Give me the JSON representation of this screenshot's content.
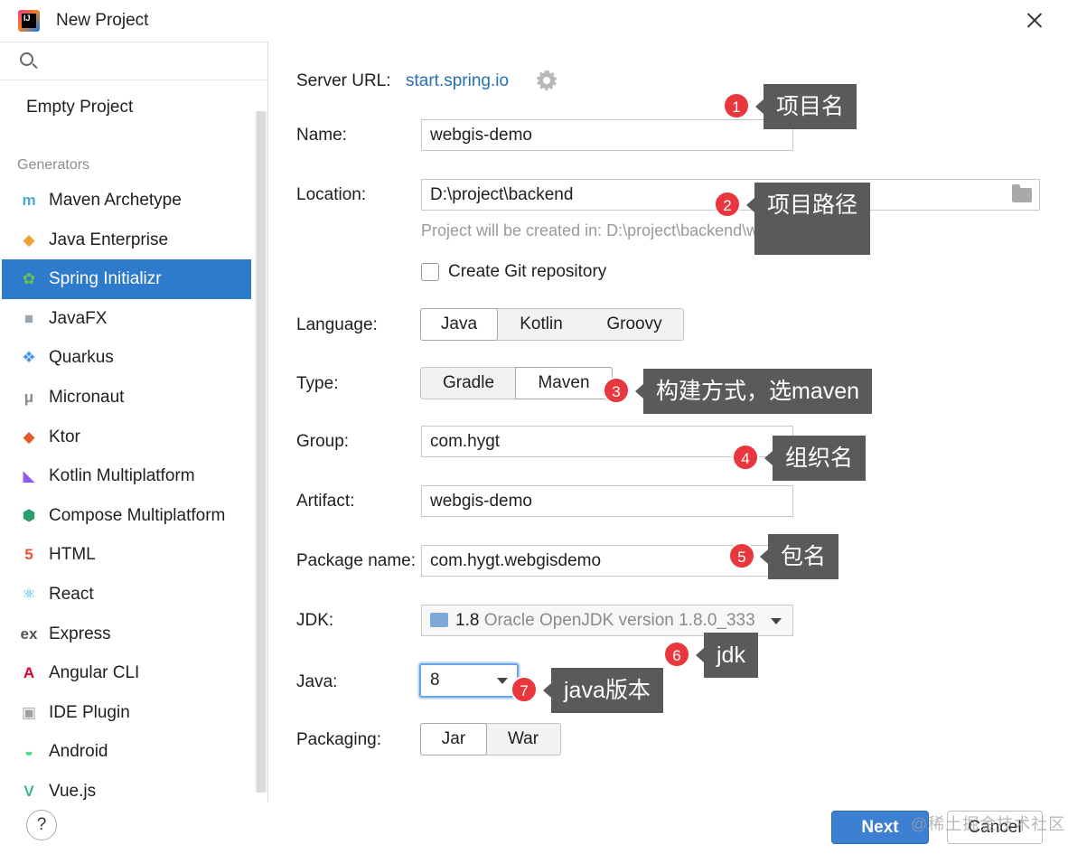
{
  "window": {
    "title": "New Project"
  },
  "sidebar": {
    "search_placeholder": "",
    "empty_project": "Empty Project",
    "generators_label": "Generators",
    "items": [
      {
        "label": "Maven Archetype",
        "icon": "maven-icon",
        "glyph": "m",
        "color": "#4aa8e0"
      },
      {
        "label": "Java Enterprise",
        "icon": "java-enterprise-icon",
        "glyph": "◆",
        "color": "#f0a030"
      },
      {
        "label": "Spring Initializr",
        "icon": "spring-icon",
        "glyph": "✿",
        "color": "#6cc24a",
        "selected": true
      },
      {
        "label": "JavaFX",
        "icon": "javafx-icon",
        "glyph": "■",
        "color": "#9aa7b4"
      },
      {
        "label": "Quarkus",
        "icon": "quarkus-icon",
        "glyph": "❖",
        "color": "#4695eb"
      },
      {
        "label": "Micronaut",
        "icon": "micronaut-icon",
        "glyph": "μ",
        "color": "#8a8a8a"
      },
      {
        "label": "Ktor",
        "icon": "ktor-icon",
        "glyph": "◆",
        "color": "#e35a2f"
      },
      {
        "label": "Kotlin Multiplatform",
        "icon": "kotlin-icon",
        "glyph": "◣",
        "color": "#8f5bf5"
      },
      {
        "label": "Compose Multiplatform",
        "icon": "compose-icon",
        "glyph": "⬢",
        "color": "#2a9d6e"
      },
      {
        "label": "HTML",
        "icon": "html5-icon",
        "glyph": "5",
        "color": "#e4572e"
      },
      {
        "label": "React",
        "icon": "react-icon",
        "glyph": "⚛",
        "color": "#3bb5d9"
      },
      {
        "label": "Express",
        "icon": "express-icon",
        "glyph": "ex",
        "color": "#555555"
      },
      {
        "label": "Angular CLI",
        "icon": "angular-icon",
        "glyph": "A",
        "color": "#d6002f"
      },
      {
        "label": "IDE Plugin",
        "icon": "ide-plugin-icon",
        "glyph": "▣",
        "color": "#a0a0a0"
      },
      {
        "label": "Android",
        "icon": "android-icon",
        "glyph": "◒",
        "color": "#3ddc84"
      },
      {
        "label": "Vue.js",
        "icon": "vue-icon",
        "glyph": "V",
        "color": "#41b883"
      }
    ]
  },
  "form": {
    "server_url_label": "Server URL:",
    "server_url": "start.spring.io",
    "name_label": "Name:",
    "name_value": "webgis-demo",
    "location_label": "Location:",
    "location_value": "D:\\project\\backend",
    "location_hint": "Project will be created in: D:\\project\\backend\\webgis-demo",
    "git_label": "Create Git repository",
    "language_label": "Language:",
    "languages": [
      "Java",
      "Kotlin",
      "Groovy"
    ],
    "type_label": "Type:",
    "types": [
      "Gradle",
      "Maven"
    ],
    "group_label": "Group:",
    "group_value": "com.hygt",
    "artifact_label": "Artifact:",
    "artifact_value": "webgis-demo",
    "package_label": "Package name:",
    "package_value": "com.hygt.webgisdemo",
    "jdk_label": "JDK:",
    "jdk_version": "1.8",
    "jdk_desc": "Oracle OpenJDK version 1.8.0_333",
    "java_label": "Java:",
    "java_value": "8",
    "packaging_label": "Packaging:",
    "packagings": [
      "Jar",
      "War"
    ]
  },
  "annotations": [
    {
      "num": "1",
      "text": "项目名"
    },
    {
      "num": "2",
      "text": "项目路径"
    },
    {
      "num": "3",
      "text": "构建方式，选maven"
    },
    {
      "num": "4",
      "text": "组织名"
    },
    {
      "num": "5",
      "text": "包名"
    },
    {
      "num": "6",
      "text": "jdk"
    },
    {
      "num": "7",
      "text": "java版本"
    }
  ],
  "footer": {
    "help": "?",
    "next": "Next",
    "cancel": "Cancel",
    "watermark": "@稀土掘金技术社区"
  }
}
